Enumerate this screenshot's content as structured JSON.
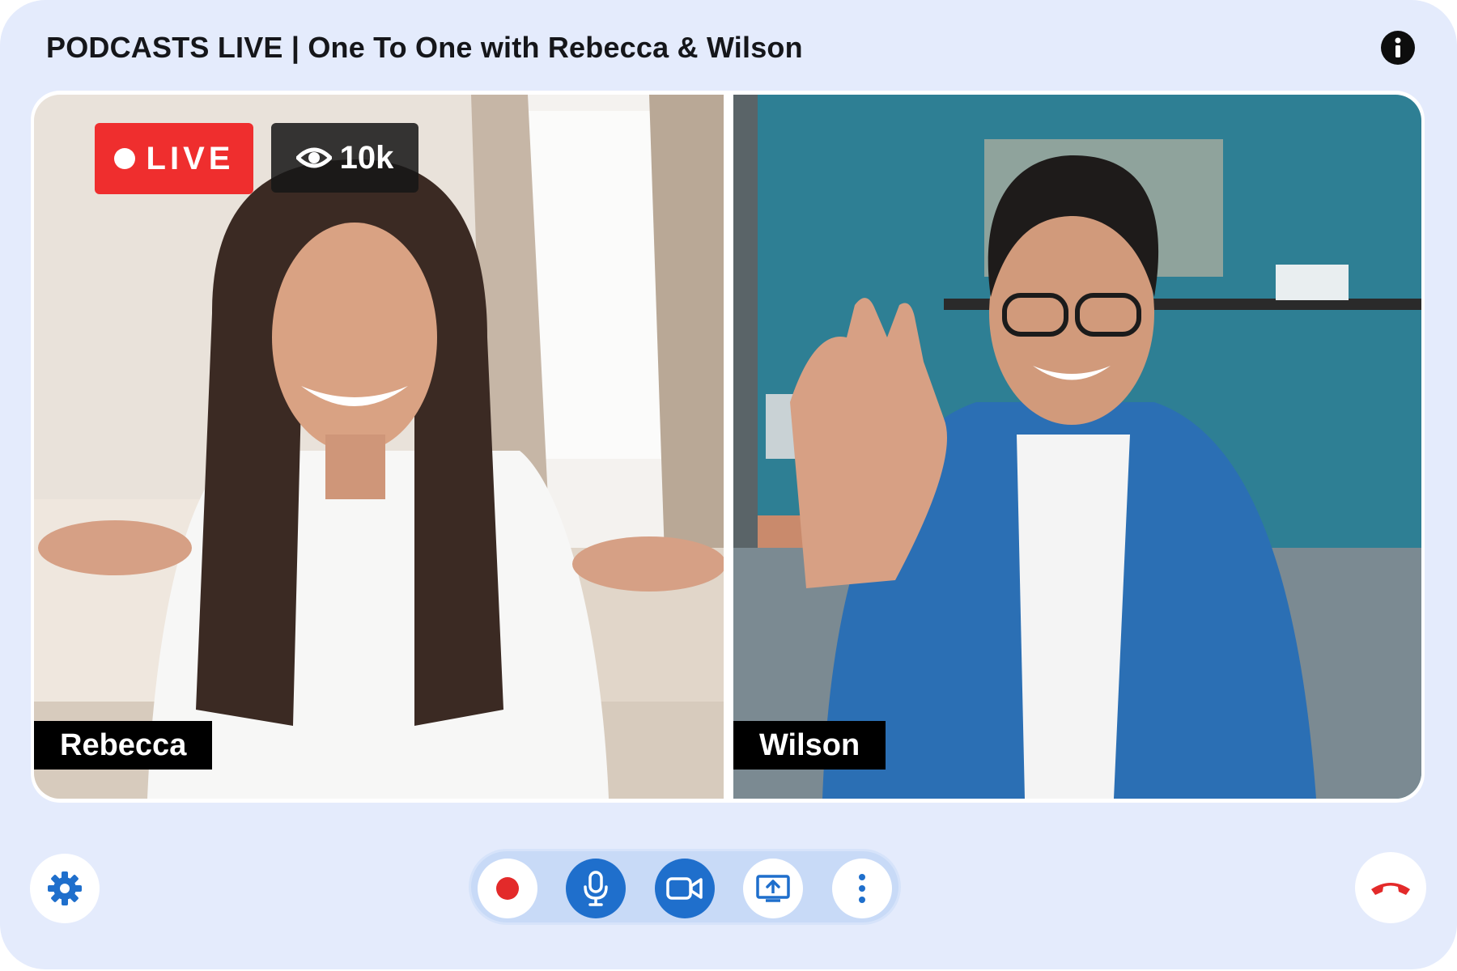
{
  "header": {
    "title": "PODCASTS LIVE | One To One with Rebecca & Wilson",
    "info_icon": "info-icon"
  },
  "stream": {
    "live_label": "LIVE",
    "viewers": "10k",
    "viewer_icon": "eye-icon"
  },
  "participants": [
    {
      "name": "Rebecca"
    },
    {
      "name": "Wilson"
    }
  ],
  "controls": {
    "settings_icon": "gear-icon",
    "record_icon": "record-icon",
    "mic_icon": "microphone-icon",
    "camera_icon": "video-camera-icon",
    "share_icon": "share-screen-icon",
    "more_icon": "more-vertical-icon",
    "hangup_icon": "end-call-icon"
  },
  "colors": {
    "background": "#e4ebfc",
    "live_red": "#ef2e2e",
    "accent_blue": "#1f6fcc",
    "hangup_red": "#e32a2a"
  }
}
